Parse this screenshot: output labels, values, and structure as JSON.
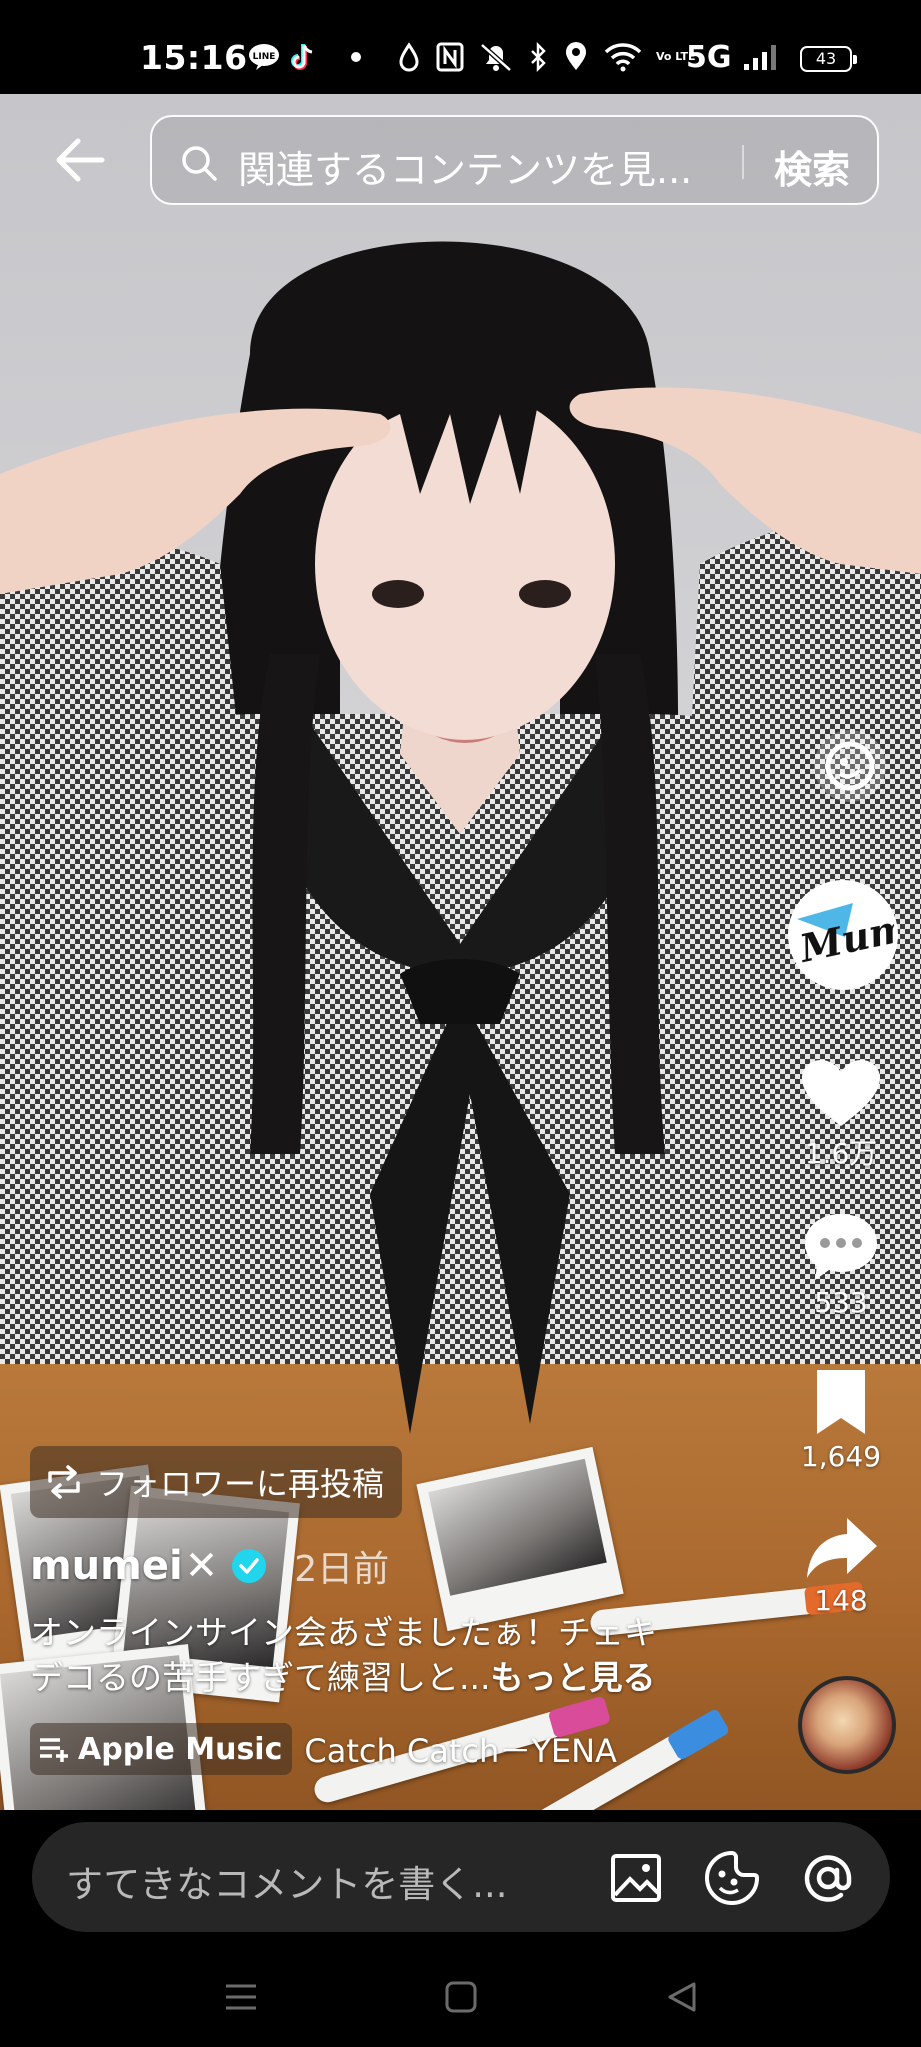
{
  "status_bar": {
    "time": "15:16",
    "network": "5G",
    "volte": "Vo LTE",
    "battery": "43",
    "icons": [
      "line-icon",
      "tiktok-icon",
      "dot-icon",
      "drop-icon",
      "nfc-icon",
      "mute-icon",
      "bluetooth-icon",
      "location-icon",
      "wifi-icon",
      "signal-icon"
    ]
  },
  "search": {
    "placeholder": "関連するコンテンツを見...",
    "button": "検索"
  },
  "rail": {
    "avatar_text": "Mumei",
    "likes": "1.6万",
    "comments": "533",
    "saves": "1,649",
    "shares": "148"
  },
  "post": {
    "repost_label": "フォロワーに再投稿",
    "author": "mumei",
    "author_suffix": "✕",
    "date": "2日前",
    "caption_line1": "オンラインサイン会あざましたぁ！チェキ",
    "caption_line2": "デコるの苦手すぎて練習しと...",
    "more": "もっと見る",
    "music_label": "Apple Music",
    "song": "Catch Catch－YENA"
  },
  "comment": {
    "placeholder": "すてきなコメントを書く..."
  },
  "colors": {
    "verified": "#20d5ec",
    "comment_bar": "#262626",
    "background": "#000000"
  }
}
